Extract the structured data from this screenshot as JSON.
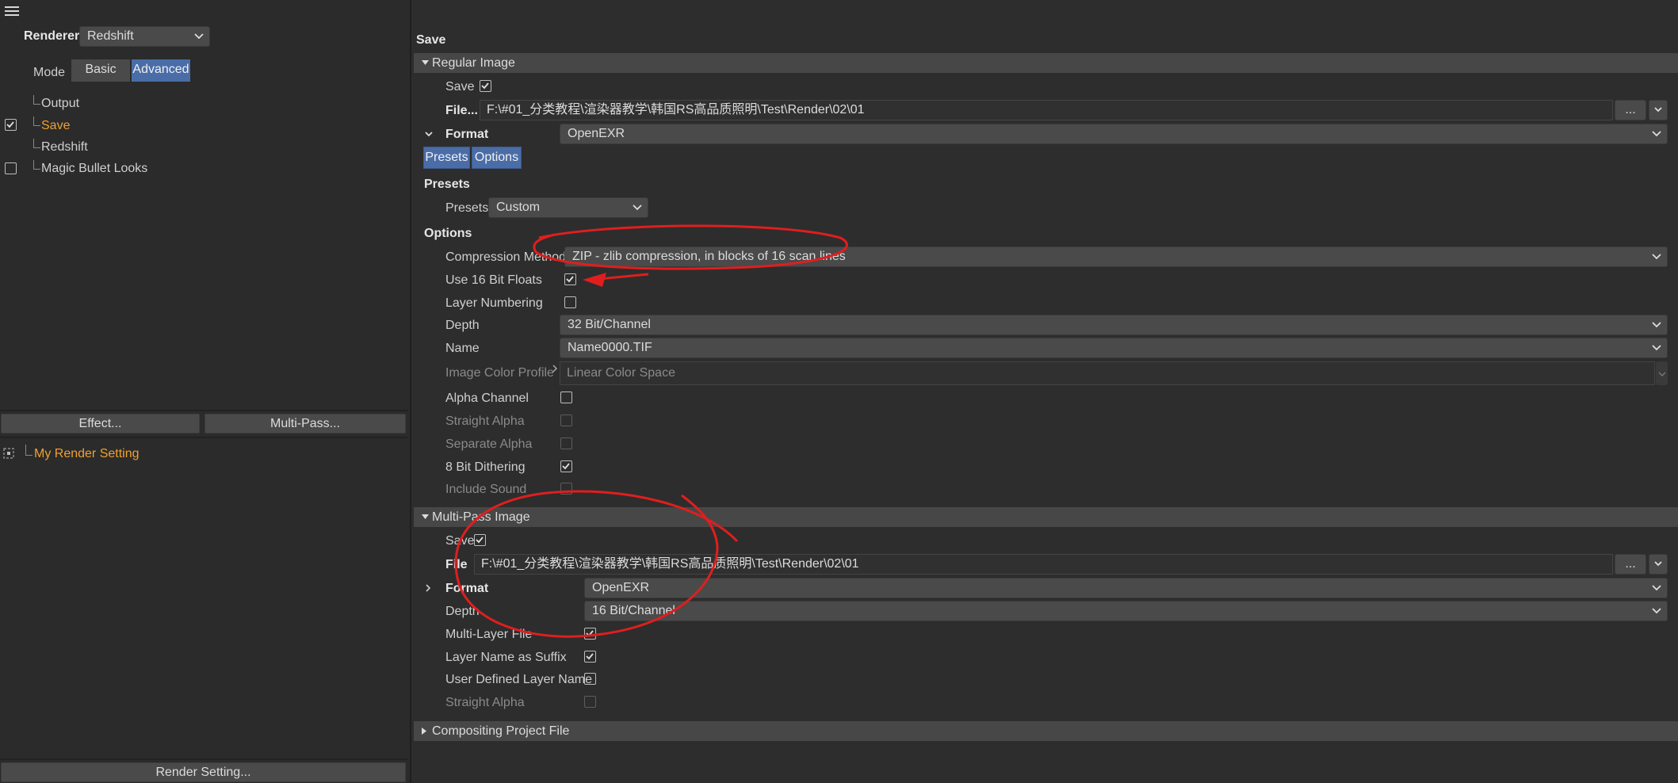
{
  "left_panel": {
    "renderer_label": "Renderer",
    "renderer_value": "Redshift",
    "mode_label": "Mode",
    "mode_basic": "Basic",
    "mode_advanced": "Advanced",
    "tree": [
      {
        "label": "Output",
        "checked": null
      },
      {
        "label": "Save",
        "checked": true
      },
      {
        "label": "Redshift",
        "checked": null
      },
      {
        "label": "Magic Bullet Looks",
        "checked": false
      }
    ],
    "effect_button": "Effect...",
    "multipass_button": "Multi-Pass...",
    "render_setting_name": "My Render Setting",
    "render_setting_button": "Render Setting..."
  },
  "save_panel": {
    "title": "Save",
    "regular_image": {
      "header": "Regular Image",
      "save_label": "Save",
      "file_label": "File...",
      "file_path": "F:\\#01_分类教程\\渲染器教学\\韩国RS高品质照明\\Test\\Render\\02\\01",
      "browse_label": "...",
      "format_label": "Format",
      "format_value": "OpenEXR",
      "tab_presets": "Presets",
      "tab_options": "Options",
      "presets_heading": "Presets",
      "presets_label": "Presets",
      "presets_value": "Custom",
      "options_heading": "Options",
      "compression_label": "Compression Method",
      "compression_value": "ZIP - zlib compression, in blocks of 16 scan lines",
      "use16_label": "Use 16 Bit Floats",
      "layer_numbering_label": "Layer Numbering",
      "depth_label": "Depth",
      "depth_value": "32 Bit/Channel",
      "name_label": "Name",
      "name_value": "Name0000.TIF",
      "color_profile_label": "Image Color Profile",
      "color_profile_value": "Linear Color Space",
      "alpha_label": "Alpha Channel",
      "straight_alpha_label": "Straight Alpha",
      "separate_alpha_label": "Separate Alpha",
      "dithering_label": "8 Bit Dithering",
      "include_sound_label": "Include Sound"
    },
    "multipass_image": {
      "header": "Multi-Pass Image",
      "save_label": "Save",
      "file_label": "File",
      "file_path": "F:\\#01_分类教程\\渲染器教学\\韩国RS高品质照明\\Test\\Render\\02\\01",
      "browse_label": "...",
      "format_label": "Format",
      "format_value": "OpenEXR",
      "depth_label": "Depth",
      "depth_value": "16 Bit/Channel",
      "multilayer_label": "Multi-Layer File",
      "layer_suffix_label": "Layer Name as Suffix",
      "user_layer_label": "User Defined Layer Name",
      "straight_alpha_label": "Straight Alpha"
    },
    "compositing": {
      "header": "Compositing Project File"
    }
  },
  "colors": {
    "accent_blue": "#4a6da8",
    "active_orange": "#f0a030",
    "annotation_red": "#e01e1e"
  }
}
